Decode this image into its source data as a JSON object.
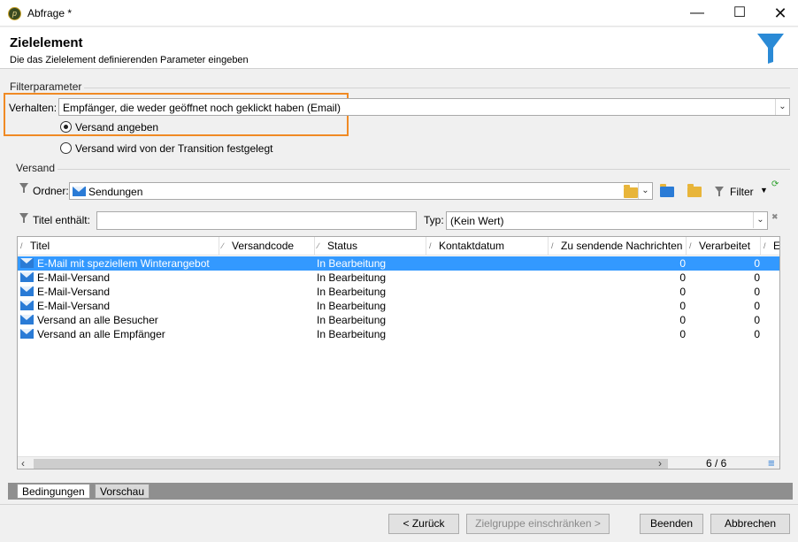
{
  "window": {
    "title": "Abfrage *",
    "min_icon": "minimize-icon",
    "max_icon": "maximize-icon",
    "close_icon": "close-icon"
  },
  "header": {
    "title": "Zielelement",
    "subtitle": "Die das Zielelement definierenden Parameter eingeben",
    "icon": "funnel-icon"
  },
  "filter": {
    "section_label": "Filterparameter",
    "behavior_label": "Verhalten:",
    "behavior_value": "Empfänger, die weder geöffnet noch geklickt haben (Email)",
    "radio_specify": "Versand angeben",
    "radio_transition": "Versand wird von der Transition festgelegt",
    "highlight_color": "#f08a24"
  },
  "delivery": {
    "section_label": "Versand",
    "folder_label": "Ordner:",
    "folder_value": "Sendungen",
    "filter_button": "Filter",
    "title_contains_label": "Titel enthält:",
    "title_contains_value": "",
    "type_label": "Typ:",
    "type_value": "(Kein Wert)"
  },
  "grid": {
    "columns": [
      "Titel",
      "Versandcode",
      "Status",
      "Kontaktdatum",
      "Zu sendende Nachrichten",
      "Verarbeitet",
      "Er"
    ],
    "rows": [
      {
        "title": "E-Mail mit speziellem Winterangebot",
        "code": "",
        "status": "In Bearbeitung",
        "date": "",
        "to_send": "0",
        "processed": "0",
        "selected": true
      },
      {
        "title": "E-Mail-Versand",
        "code": "",
        "status": "In Bearbeitung",
        "date": "",
        "to_send": "0",
        "processed": "0"
      },
      {
        "title": "E-Mail-Versand",
        "code": "",
        "status": "In Bearbeitung",
        "date": "",
        "to_send": "0",
        "processed": "0"
      },
      {
        "title": "E-Mail-Versand",
        "code": "",
        "status": "In Bearbeitung",
        "date": "",
        "to_send": "0",
        "processed": "0"
      },
      {
        "title": "Versand an alle Besucher",
        "code": "",
        "status": "In Bearbeitung",
        "date": "",
        "to_send": "0",
        "processed": "0"
      },
      {
        "title": "Versand an alle Empfänger",
        "code": "",
        "status": "In Bearbeitung",
        "date": "",
        "to_send": "0",
        "processed": "0"
      }
    ],
    "page_count": "6 / 6",
    "selection_color": "#3399ff"
  },
  "tabs": [
    "Bedingungen",
    "Vorschau"
  ],
  "buttons": {
    "back": "< Zurück",
    "narrow": "Zielgruppe einschränken >",
    "finish": "Beenden",
    "cancel": "Abbrechen"
  }
}
